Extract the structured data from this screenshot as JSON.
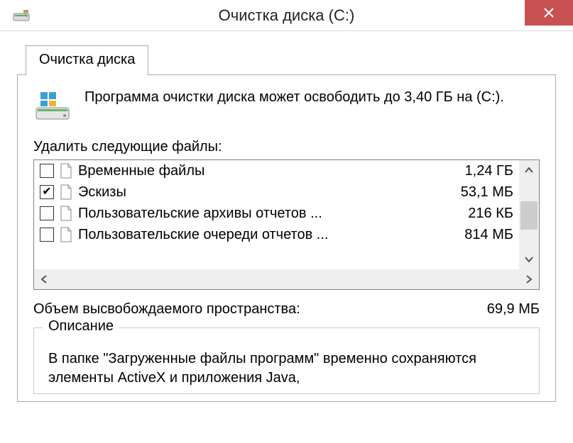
{
  "title": "Очистка диска  (C:)",
  "tab_label": "Очистка диска",
  "intro": "Программа очистки диска может освободить до 3,40 ГБ на  (C:).",
  "list_label": "Удалить следующие файлы:",
  "files": [
    {
      "checked": false,
      "name": "Временные файлы",
      "size": "1,24 ГБ"
    },
    {
      "checked": true,
      "name": "Эскизы",
      "size": "53,1 МБ"
    },
    {
      "checked": false,
      "name": "Пользовательские архивы отчетов ...",
      "size": "216 КБ"
    },
    {
      "checked": false,
      "name": "Пользовательские очереди отчетов ...",
      "size": "814 МБ"
    }
  ],
  "freespace_label": "Объем высвобождаемого пространства:",
  "freespace_value": "69,9 МБ",
  "group_title": "Описание",
  "description": "В папке \"Загруженные файлы программ\" временно сохраняются элементы ActiveX и приложения Java,"
}
